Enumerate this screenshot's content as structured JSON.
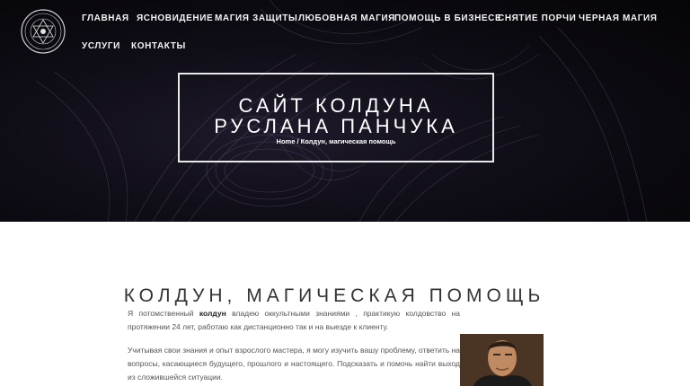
{
  "nav": {
    "items": [
      "ГЛАВНАЯ",
      "ЯСНОВИДЕНИЕ",
      "МАГИЯ ЗАЩИТЫ",
      "ЛЮБОВНАЯ МАГИЯ",
      "ПОМОЩЬ В БИЗНЕСЕ",
      "СНЯТИЕ ПОРЧИ",
      "ЧЕРНАЯ МАГИЯ",
      "УСЛУГИ",
      "КОНТАКТЫ"
    ]
  },
  "hero": {
    "title_line1": "САЙТ КОЛДУНА",
    "title_line2": "РУСЛАНА ПАНЧУКА",
    "breadcrumb_home": "Home",
    "breadcrumb_sep": " / ",
    "breadcrumb_current": "Колдун, магическая помощь"
  },
  "content": {
    "heading": "КОЛДУН, МАГИЧЕСКАЯ ПОМОЩЬ",
    "p1_before": "Я потомственный ",
    "p1_bold": "колдун",
    "p1_after": " владею оккультными знаниями , практикую колдовство на протяжении 24 лет, работаю как дистанционно так и на выезде к клиенту.",
    "p2": "Учитывая свои знания и опыт взрослого мастера, я могу изучить вашу проблему, ответить на вопросы, касающиеся будущего, прошлого и настоящего. Подсказать и помочь найти выход из сложившейся ситуации."
  },
  "colors": {
    "hero_bg": "#0f0d16",
    "nav_text": "#f2f2f2",
    "heading_text": "#333333",
    "body_text": "#555555"
  },
  "icons": {
    "logo": "esoteric-seal-logo"
  }
}
